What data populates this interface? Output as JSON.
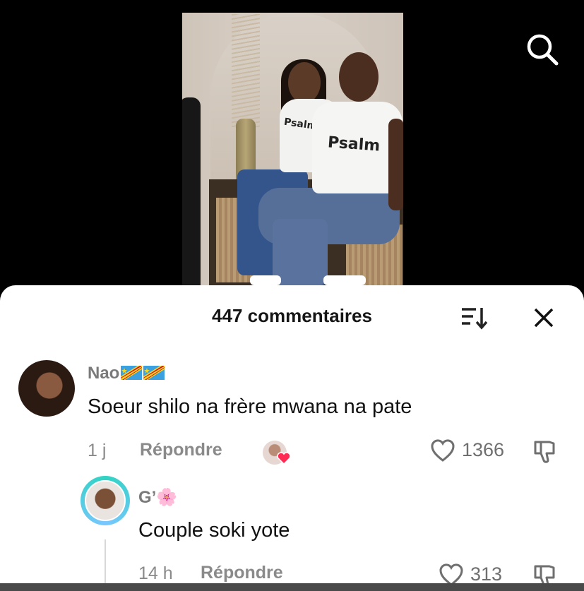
{
  "header": {
    "comment_count": "447 commentaires"
  },
  "video": {
    "shirt_logo": "Psalm"
  },
  "comments": [
    {
      "username": "Nao",
      "flags": [
        "flag-cd-icon",
        "flag-cd-icon"
      ],
      "text": "Soeur shilo na frère mwana na pate",
      "time": "1 j",
      "reply_label": "Répondre",
      "likes": "1366",
      "creator_liked": true
    },
    {
      "username": "G’",
      "emoji": "🌸",
      "text": "Couple soki yote",
      "time": "14 h",
      "reply_label": "Répondre",
      "likes": "313"
    }
  ],
  "icons": {
    "search": "search-icon",
    "sort": "sort-icon",
    "close": "close-icon",
    "like": "heart-outline-icon",
    "dislike": "thumbs-down-icon"
  },
  "colors": {
    "background": "#000000",
    "sheet": "#ffffff",
    "text": "#111111",
    "muted": "#8a8a8a",
    "creator_heart": "#fe2c55",
    "story_ring": "#2fd3c3"
  }
}
